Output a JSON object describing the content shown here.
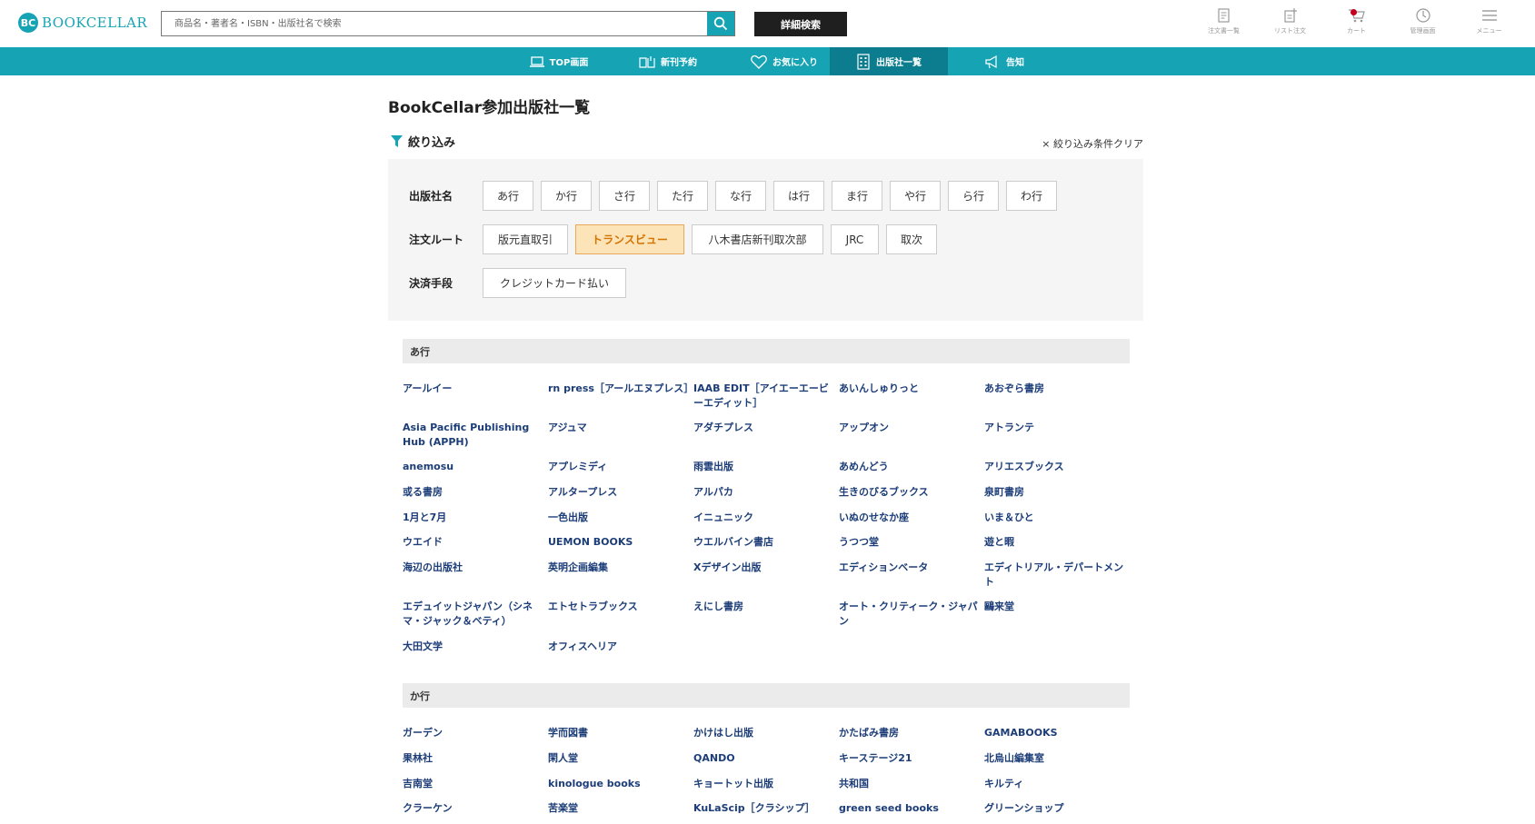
{
  "header": {
    "logo_mark": "BC",
    "logo_text": "BOOKCELLAR",
    "search_placeholder": "商品名・著者名・ISBN・出版社名で検索",
    "advanced_label": "詳細検索",
    "icons": [
      {
        "name": "order-history-icon",
        "label": "注文書一覧"
      },
      {
        "name": "list-order-icon",
        "label": "リスト注文"
      },
      {
        "name": "cart-icon",
        "label": "カート"
      },
      {
        "name": "admin-icon",
        "label": "管理画面"
      },
      {
        "name": "menu-icon",
        "label": "メニュー"
      }
    ]
  },
  "nav": {
    "items": [
      {
        "label": "TOP画面",
        "icon": "laptop-icon"
      },
      {
        "label": "新刊予約",
        "icon": "book-open-icon"
      },
      {
        "label": "お気に入り",
        "icon": "heart-icon"
      },
      {
        "label": "出版社一覧",
        "icon": "building-icon",
        "active": true
      },
      {
        "label": "告知",
        "icon": "megaphone-icon"
      }
    ]
  },
  "page": {
    "title": "BookCellar参加出版社一覧",
    "filter_heading": "絞り込み",
    "clear_label": "× 絞り込み条件クリア"
  },
  "filters": {
    "publisher": {
      "label": "出版社名",
      "options": [
        "あ行",
        "か行",
        "さ行",
        "た行",
        "な行",
        "は行",
        "ま行",
        "や行",
        "ら行",
        "わ行"
      ]
    },
    "route": {
      "label": "注文ルート",
      "options": [
        "版元直取引",
        "トランスビュー",
        "八木書店新刊取次部",
        "JRC",
        "取次"
      ],
      "selected": "トランスビュー"
    },
    "payment": {
      "label": "決済手段",
      "options": [
        "クレジットカード払い"
      ]
    }
  },
  "sections": [
    {
      "heading": "あ行",
      "publishers": [
        "アールイー",
        "rn press［アールエヌプレス］",
        "IAAB EDIT［アイエーエービーエディット］",
        "あいんしゅりっと",
        "あおぞら書房",
        "Asia Pacific Publishing Hub (APPH)",
        "アジュマ",
        "アダチプレス",
        "アップオン",
        "アトランテ",
        "anemosu",
        "アプレミディ",
        "雨雲出版",
        "あめんどう",
        "アリエスブックス",
        "或る書房",
        "アルタープレス",
        "アルパカ",
        "生きのびるブックス",
        "泉町書房",
        "1月と7月",
        "一色出版",
        "イニュニック",
        "いぬのせなか座",
        "いま＆ひと",
        "ウエイド",
        "UEMON BOOKS",
        "ウエルバイン書店",
        "うつつ堂",
        "遊と暇",
        "海辺の出版社",
        "英明企画編集",
        "Xデザイン出版",
        "エディションベータ",
        "エディトリアル・デパートメント",
        "エデュイットジャパン（シネマ・ジャック＆ベティ）",
        "エトセトラブックス",
        "えにし書房",
        "オート・クリティーク・ジャパン",
        "鷗来堂",
        "大田文学",
        "オフィスヘリア"
      ]
    },
    {
      "heading": "か行",
      "publishers": [
        "ガーデン",
        "学而図書",
        "かけはし出版",
        "かたばみ書房",
        "GAMABOOKS",
        "果林社",
        "閑人堂",
        "QANDO",
        "キーステージ21",
        "北烏山編集室",
        "吉南堂",
        "kinologue books",
        "キョートット出版",
        "共和国",
        "キルティ",
        "クラーケン",
        "苦楽堂",
        "KuLaScip［クラシップ］",
        "green seed books",
        "グリーンショップ"
      ]
    }
  ]
}
